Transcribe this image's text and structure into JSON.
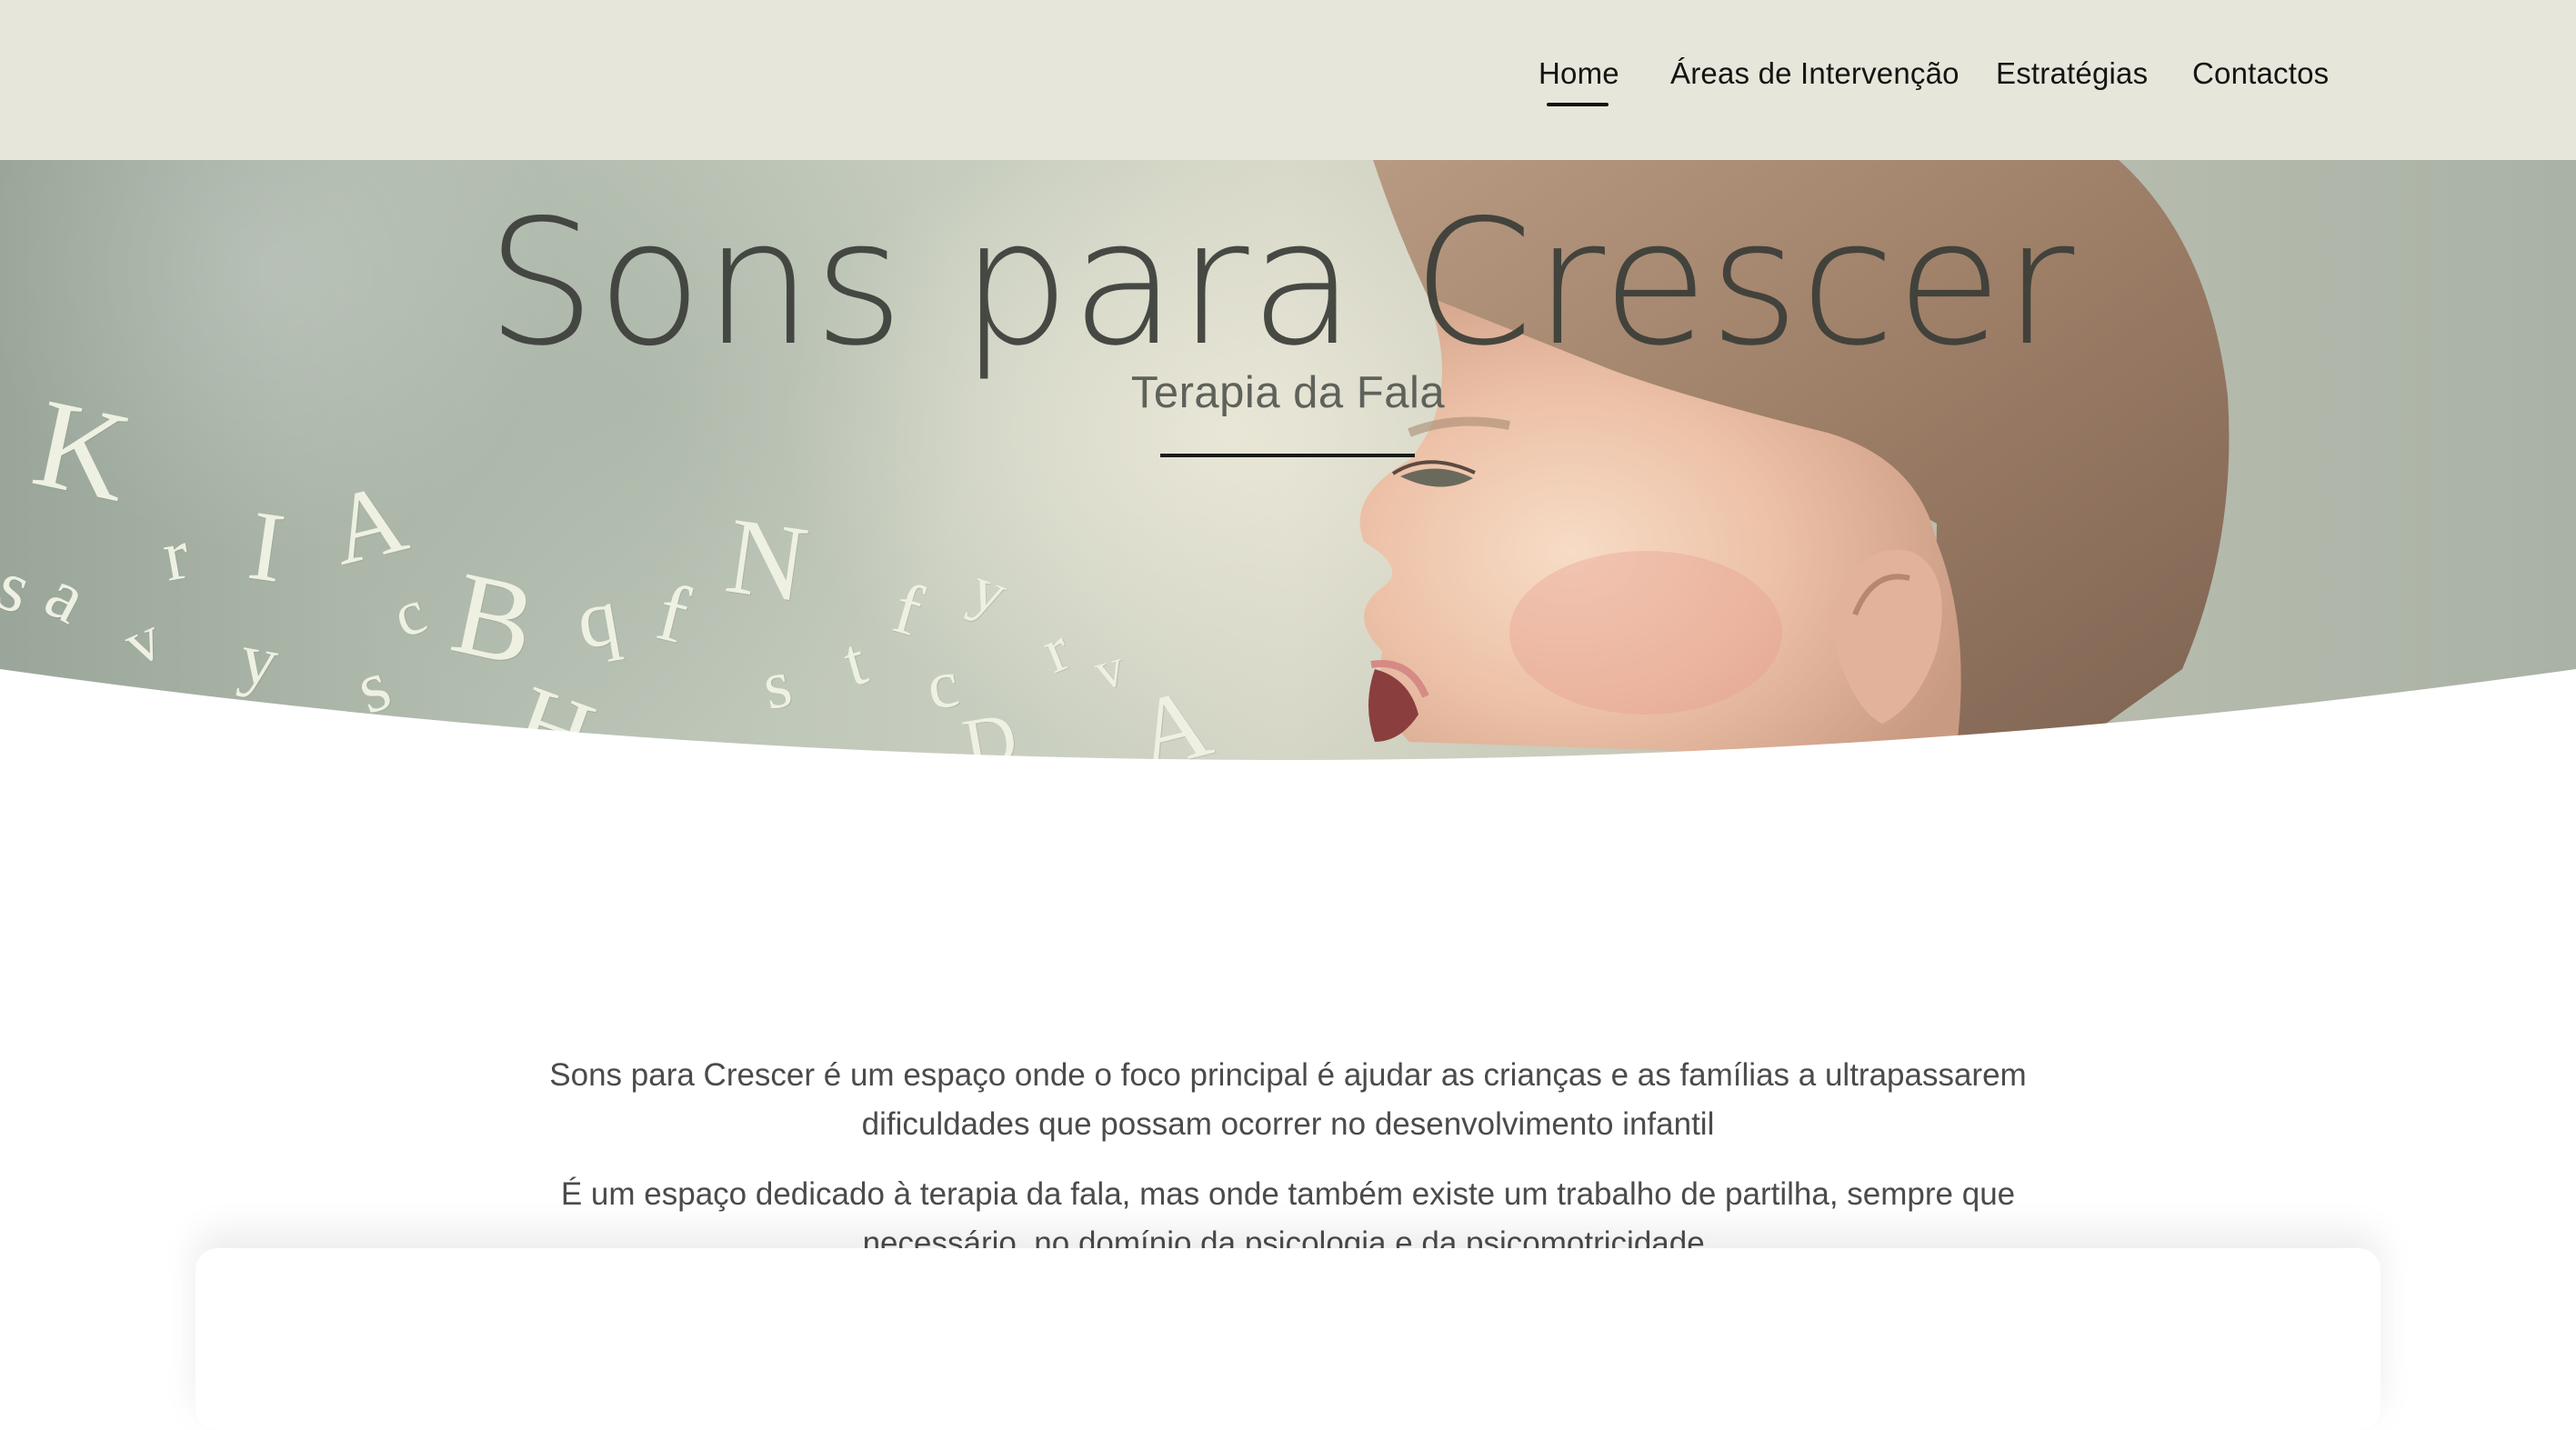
{
  "nav": {
    "items": [
      {
        "label": "Home",
        "active": true
      },
      {
        "label": "Áreas de Intervenção",
        "active": false
      },
      {
        "label": "Estratégias",
        "active": false
      },
      {
        "label": "Contactos",
        "active": false
      }
    ]
  },
  "hero": {
    "title": "Sons para Crescer",
    "subtitle": "Terapia da Fala"
  },
  "intro": {
    "paragraph_1": "Sons para Crescer é um espaço onde o foco principal é ajudar as crianças e as famílias a ultrapassarem dificuldades que possam ocorrer no desenvolvimento infantil",
    "paragraph_2": "É um espaço dedicado à terapia da fala, mas onde também existe um trabalho de partilha, sempre que necessário, no domínio da psicologia e da psicomotricidade."
  },
  "colors": {
    "topbar_bg": "#e6e6da",
    "text_dark": "#141414",
    "body_text": "#4b4b4b"
  }
}
